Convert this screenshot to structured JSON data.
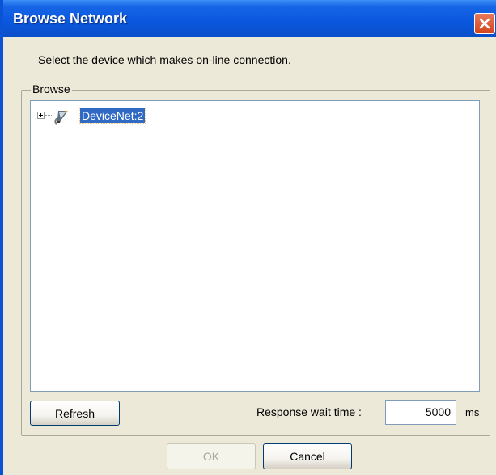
{
  "window": {
    "title": "Browse Network",
    "close_icon": "close-icon"
  },
  "instruction": "Select the device which makes on-line connection.",
  "browse_group": {
    "label": "Browse",
    "tree": {
      "items": [
        {
          "label": "DeviceNet:2",
          "icon": "network-icon",
          "expanded": false,
          "selected": true
        }
      ]
    }
  },
  "refresh_label": "Refresh",
  "response_wait": {
    "label": "Response wait time :",
    "value": "5000",
    "unit": "ms"
  },
  "buttons": {
    "ok_label": "OK",
    "ok_enabled": false,
    "cancel_label": "Cancel"
  },
  "colors": {
    "titlebar": "#0a57de",
    "selection": "#316ac5",
    "close_button": "#d4441c"
  }
}
